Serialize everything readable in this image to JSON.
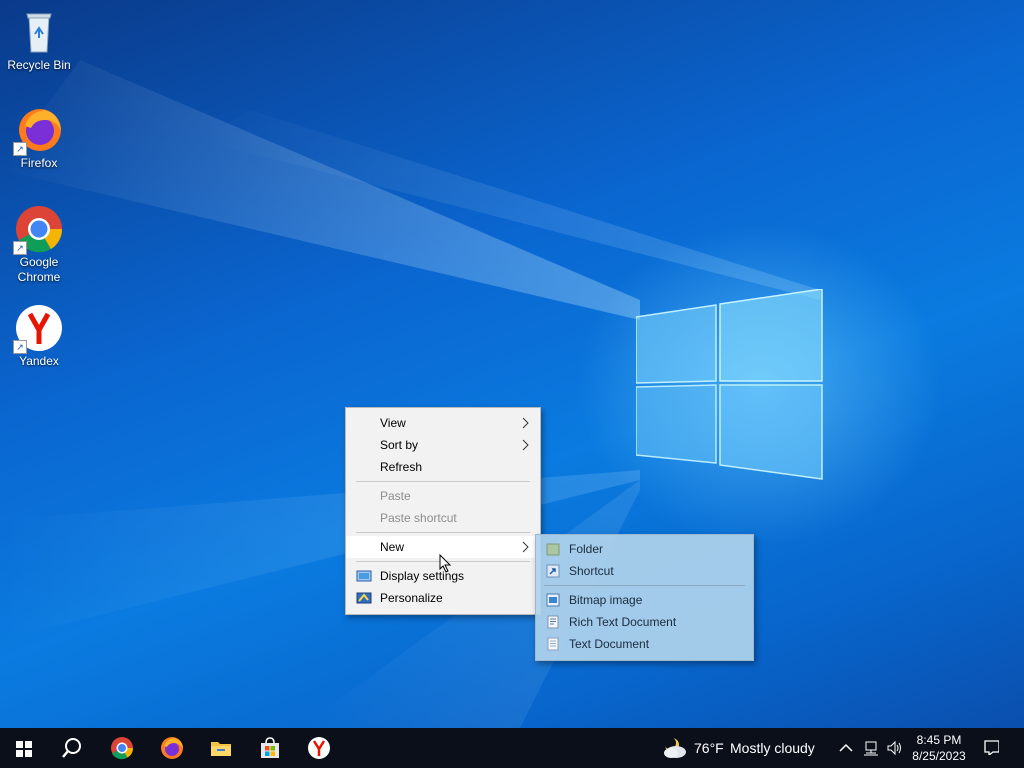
{
  "desktop_icons": [
    {
      "label": "Recycle Bin",
      "icon": "recycle-bin-icon"
    },
    {
      "label": "Firefox",
      "icon": "firefox-icon"
    },
    {
      "label": "Google Chrome",
      "icon": "chrome-icon"
    },
    {
      "label": "Yandex",
      "icon": "yandex-icon"
    }
  ],
  "context_menu": {
    "view": "View",
    "sort_by": "Sort by",
    "refresh": "Refresh",
    "paste": "Paste",
    "paste_shortcut": "Paste shortcut",
    "new": "New",
    "display_settings": "Display settings",
    "personalize": "Personalize"
  },
  "new_submenu": {
    "folder": "Folder",
    "shortcut": "Shortcut",
    "bitmap_image": "Bitmap image",
    "rich_text_document": "Rich Text Document",
    "text_document": "Text Document"
  },
  "taskbar": {
    "apps": [
      "start-icon",
      "search-icon",
      "chrome-icon",
      "firefox-icon",
      "file-explorer-icon",
      "microsoft-store-icon",
      "yandex-icon"
    ],
    "weather": {
      "temp": "76°F",
      "condition": "Mostly cloudy",
      "icon": "partly-cloudy-night-icon"
    },
    "clock": {
      "time": "8:45 PM",
      "date": "8/25/2023"
    }
  },
  "colors": {
    "taskbar": "#0a0f1a",
    "desktop_accent": "#0a7be0",
    "submenu_bg": "#b0d2ec"
  }
}
